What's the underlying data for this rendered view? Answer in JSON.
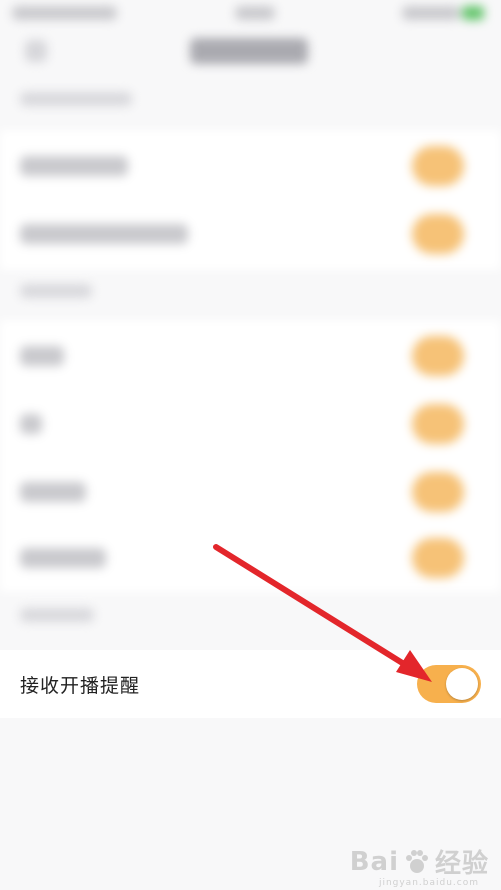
{
  "setting_row": {
    "label": "接收开播提醒",
    "toggle_on": true
  },
  "colors": {
    "accent": "#f7b04d",
    "arrow": "#e3262b",
    "background": "#f8f8f9"
  },
  "watermark": {
    "brand": "Bai",
    "suffix": "经验",
    "url": "jingyan.baidu.com"
  }
}
